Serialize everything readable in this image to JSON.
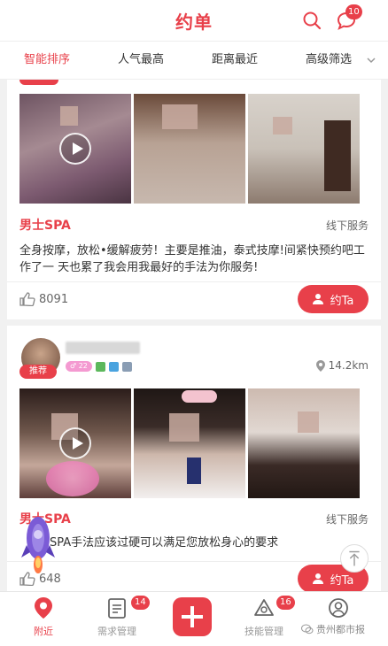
{
  "header": {
    "title": "约单",
    "message_badge": "10"
  },
  "sort_tabs": [
    {
      "label": "智能排序",
      "active": true
    },
    {
      "label": "人气最高",
      "active": false
    },
    {
      "label": "距离最近",
      "active": false
    },
    {
      "label": "高级筛选",
      "active": false
    }
  ],
  "cards": [
    {
      "category": "男士SPA",
      "service_type": "线下服务",
      "description": "全身按摩，放松•缓解疲劳！主要是推油，泰式技摩!间紧快预约吧工作了一 天也累了我会用我最好的手法为你服务!",
      "likes": "8091",
      "action_label": "约Ta"
    },
    {
      "recommend_badge": "推荐",
      "level_tag": "22",
      "distance": "14.2km",
      "category": "男士SPA",
      "service_type": "线下服务",
      "description": "SPA手法应该过硬可以满足您放松身心的要求",
      "likes": "648",
      "action_label": "约Ta"
    }
  ],
  "tabbar": {
    "items": [
      {
        "label": "附近",
        "active": true
      },
      {
        "label": "需求管理",
        "badge": "14"
      },
      {
        "label": ""
      },
      {
        "label": "技能管理",
        "badge": "16"
      },
      {
        "label": ""
      }
    ]
  },
  "watermark": "贵州都市报",
  "colors": {
    "accent": "#e8404a",
    "text": "#333333",
    "muted": "#999999"
  }
}
